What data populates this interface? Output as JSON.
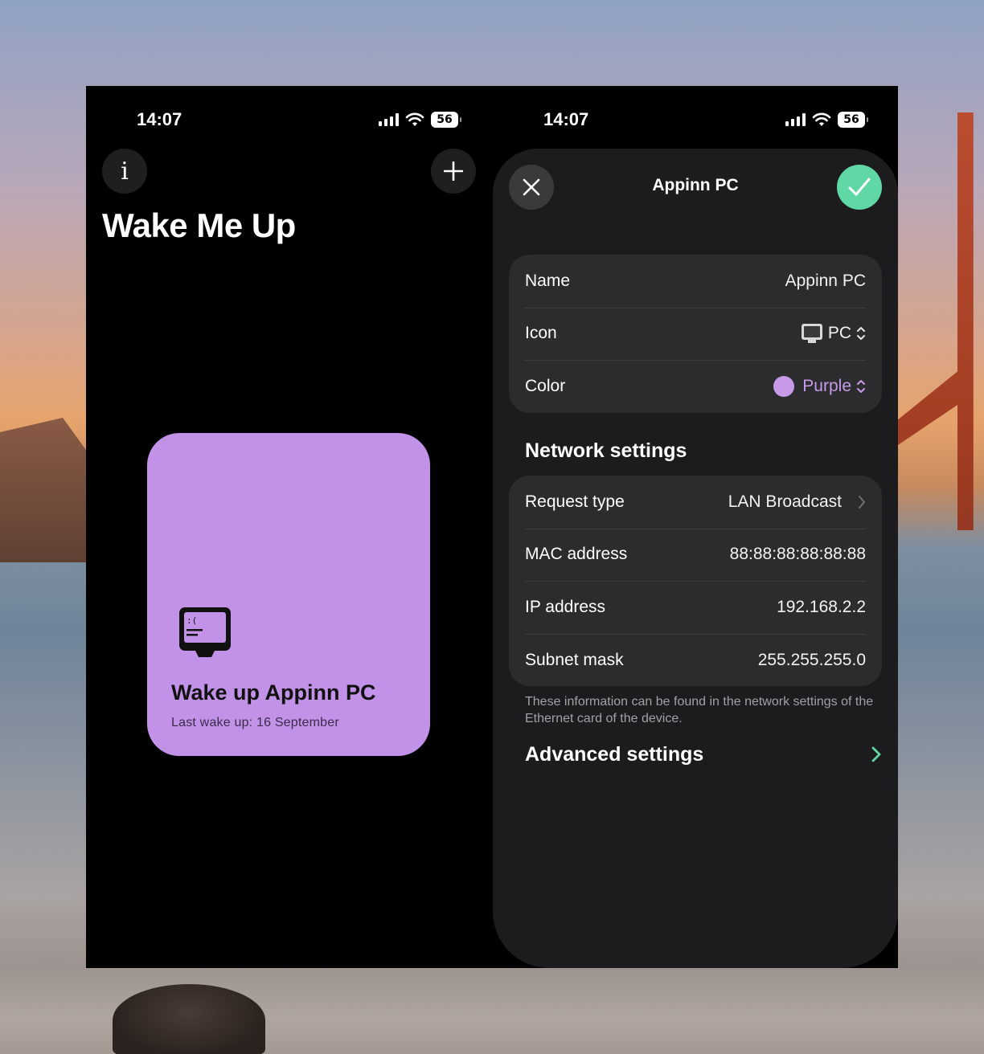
{
  "left": {
    "status": {
      "time": "14:07",
      "battery": "56"
    },
    "info_button": "i",
    "add_button": "+",
    "title": "Wake Me Up",
    "card": {
      "title": "Wake up Appinn PC",
      "subtitle": "Last wake up: 16 September",
      "color": "#c192e7",
      "icon": "pc-icon"
    }
  },
  "right": {
    "status": {
      "time": "14:07",
      "battery": "56"
    },
    "sheet_title": "Appinn PC",
    "general": [
      {
        "label": "Name",
        "value": "Appinn PC"
      },
      {
        "label": "Icon",
        "value": "PC"
      },
      {
        "label": "Color",
        "value": "Purple"
      }
    ],
    "network_header": "Network settings",
    "network": [
      {
        "label": "Request type",
        "value": "LAN Broadcast"
      },
      {
        "label": "MAC address",
        "value": "88:88:88:88:88:88"
      },
      {
        "label": "IP address",
        "value": "192.168.2.2"
      },
      {
        "label": "Subnet mask",
        "value": "255.255.255.0"
      }
    ],
    "footnote": "These information can be found in the network settings of the Ethernet card of the device.",
    "advanced_label": "Advanced settings"
  },
  "colors": {
    "accent_green": "#5fd8a5",
    "purple": "#c69ae9",
    "sheet_bg": "#1c1c1e",
    "group_bg": "#2c2c2e"
  }
}
